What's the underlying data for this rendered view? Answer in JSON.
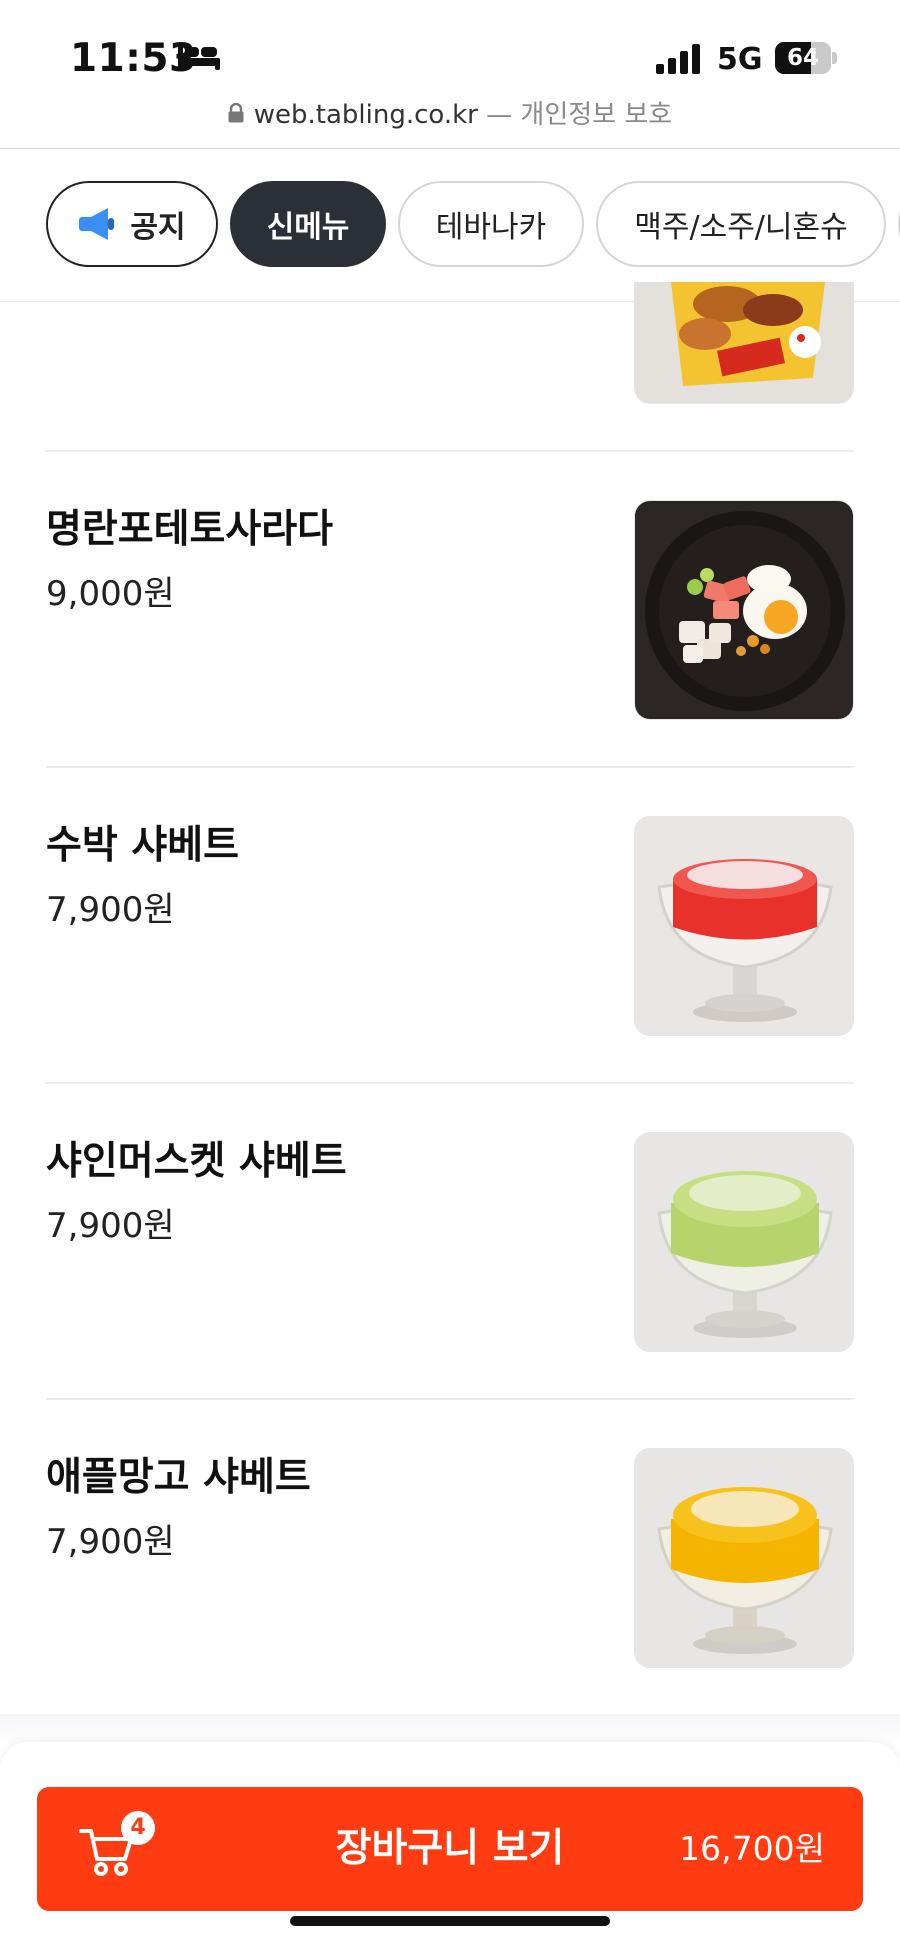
{
  "status_bar": {
    "time": "11:53",
    "network": "5G",
    "battery_percent": "64",
    "battery_level": 0.64
  },
  "browser": {
    "host": "web.tabling.co.kr",
    "privacy_note": "— 개인정보 보호"
  },
  "tabs": [
    {
      "label": "공지",
      "icon": "megaphone-icon",
      "active": false
    },
    {
      "label": "신메뉴",
      "active": true
    },
    {
      "label": "테바나카",
      "active": false
    },
    {
      "label": "맥주/소주/니혼슈",
      "active": false
    }
  ],
  "menu_items": [
    {
      "name": "명란포테토사라다",
      "price": "9,000원",
      "image": "potato-salad-photo"
    },
    {
      "name": "수박 샤베트",
      "price": "7,900원",
      "image": "watermelon-sorbet-photo"
    },
    {
      "name": "샤인머스켓 샤베트",
      "price": "7,900원",
      "image": "shine-muscat-sorbet-photo"
    },
    {
      "name": "애플망고 샤베트",
      "price": "7,900원",
      "image": "apple-mango-sorbet-photo"
    }
  ],
  "cart": {
    "label": "장바구니 보기",
    "count": "4",
    "total": "16,700원",
    "icon": "cart-icon"
  },
  "colors": {
    "accent": "#ff3b12",
    "active_tab": "#2b2f36",
    "divider": "#ebebeb",
    "megaphone": "#3a8ff5"
  }
}
